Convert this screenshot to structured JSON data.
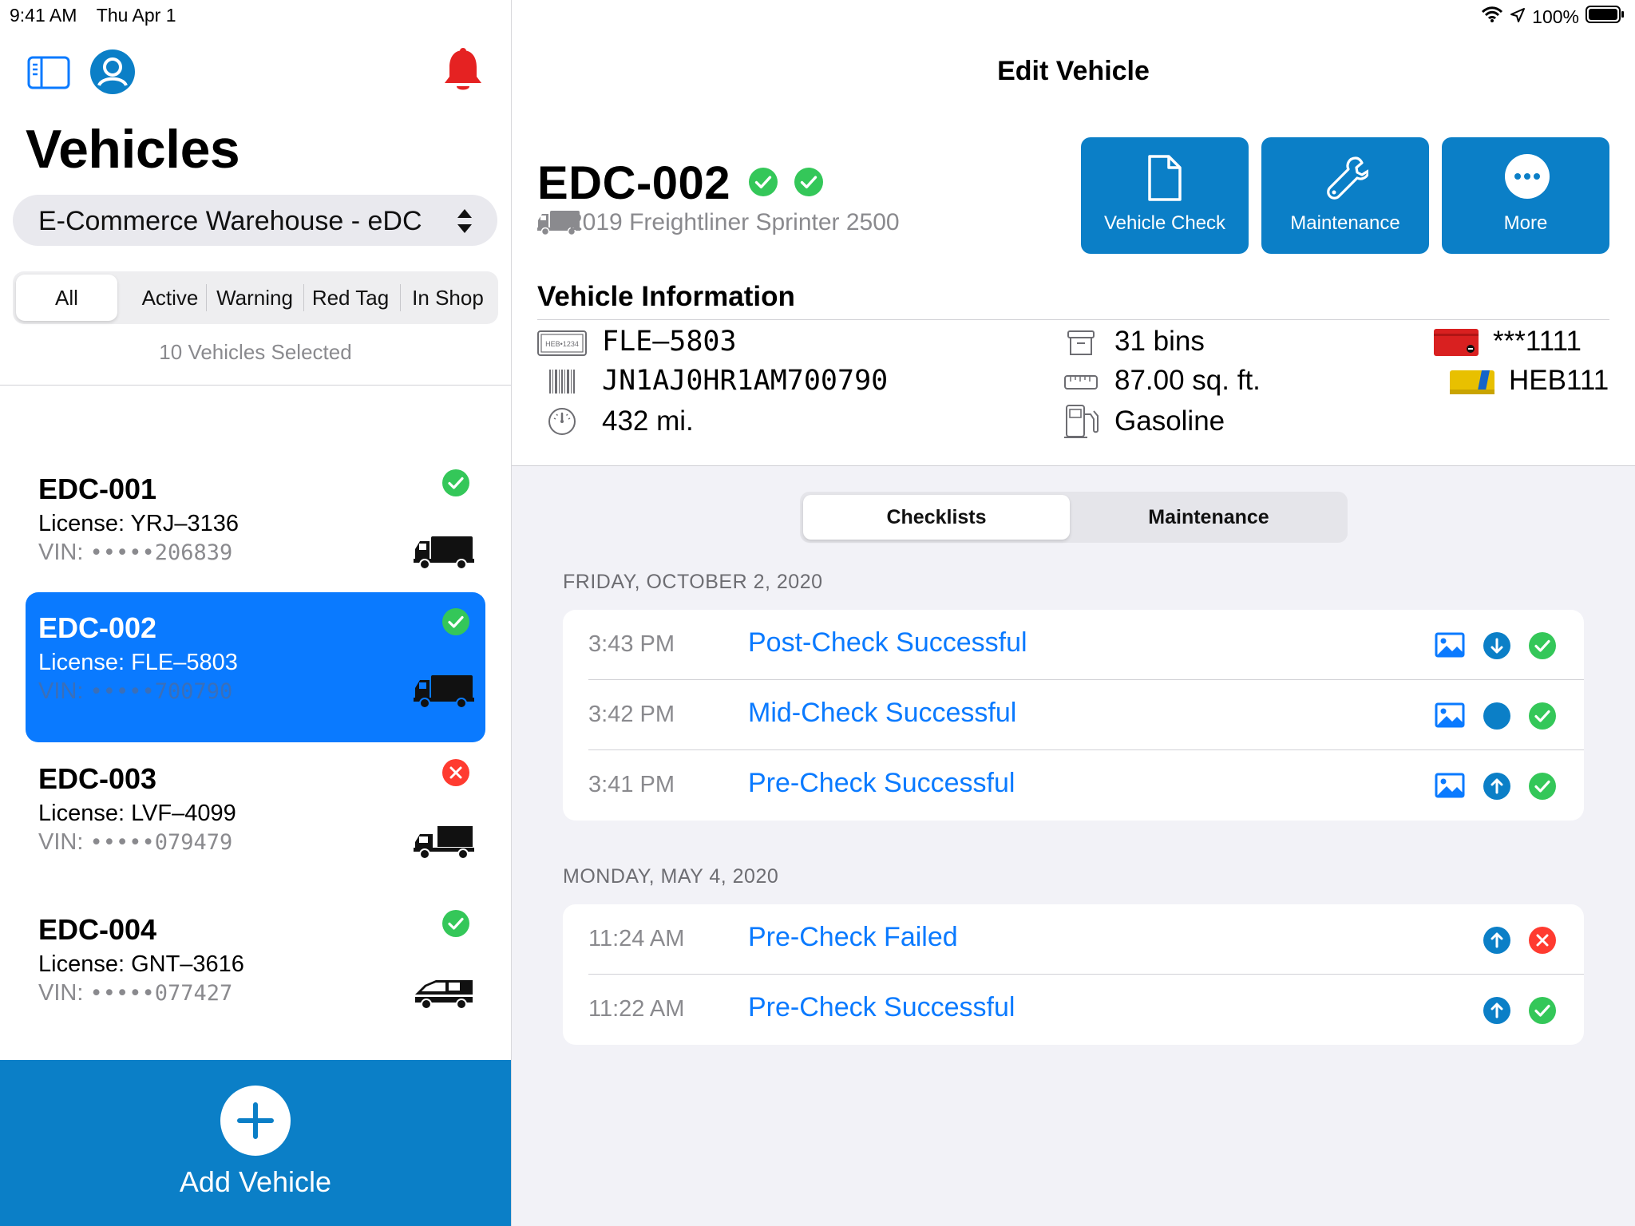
{
  "status_bar": {
    "time": "9:41 AM",
    "date": "Thu Apr 1",
    "battery": "100%"
  },
  "sidebar": {
    "title": "Vehicles",
    "location": "E-Commerce Warehouse - eDC",
    "filters": [
      "All",
      "Active",
      "Warning",
      "Red Tag",
      "In Shop"
    ],
    "selected_filter": "All",
    "selected_count": "10 Vehicles Selected",
    "vehicles": [
      {
        "name": "EDC-001",
        "license": "License: YRJ–3136",
        "vin_label": "VIN: ",
        "vin": "•••••206839",
        "status": "ok",
        "type": "box-truck"
      },
      {
        "name": "EDC-002",
        "license": "License: FLE–5803",
        "vin_label": "VIN: ",
        "vin": "•••••700790",
        "status": "ok",
        "type": "box-truck"
      },
      {
        "name": "EDC-003",
        "license": "License: LVF–4099",
        "vin_label": "VIN: ",
        "vin": "•••••079479",
        "status": "failed",
        "type": "flatbed-truck"
      },
      {
        "name": "EDC-004",
        "license": "License: GNT–3616",
        "vin_label": "VIN: ",
        "vin": "•••••077427",
        "status": "ok",
        "type": "van"
      }
    ],
    "add_label": "Add Vehicle"
  },
  "detail": {
    "nav_title": "Edit Vehicle",
    "vehicle_id": "EDC-002",
    "model": "2019 Freightliner Sprinter 2500",
    "actions": {
      "vehicle_check": "Vehicle Check",
      "maintenance": "Maintenance",
      "more": "More"
    },
    "info_heading": "Vehicle Information",
    "info": {
      "plate_icon_text": "HEB•1234",
      "plate": "FLE–5803",
      "vin": "JN1AJ0HR1AM700790",
      "mileage": "432 mi.",
      "bins": "31 bins",
      "area": "87.00 sq. ft.",
      "fuel": "Gasoline",
      "card": "***1111",
      "tag": "HEB111"
    },
    "tabs": [
      "Checklists",
      "Maintenance"
    ],
    "selected_tab": "Checklists",
    "groups": [
      {
        "date": "FRIDAY, OCTOBER 2, 2020",
        "rows": [
          {
            "time": "3:43 PM",
            "title": "Post-Check Successful"
          },
          {
            "time": "3:42 PM",
            "title": "Mid-Check Successful"
          },
          {
            "time": "3:41 PM",
            "title": "Pre-Check Successful"
          }
        ]
      },
      {
        "date": "MONDAY, MAY 4, 2020",
        "rows": [
          {
            "time": "11:24 AM",
            "title": "Pre-Check Failed"
          },
          {
            "time": "11:22 AM",
            "title": "Pre-Check Successful"
          }
        ]
      }
    ]
  },
  "colors": {
    "accent": "#0a7aff",
    "action_blue": "#0b7fc7",
    "success": "#34c759",
    "danger": "#ff3b30",
    "alert": "#e02020"
  }
}
